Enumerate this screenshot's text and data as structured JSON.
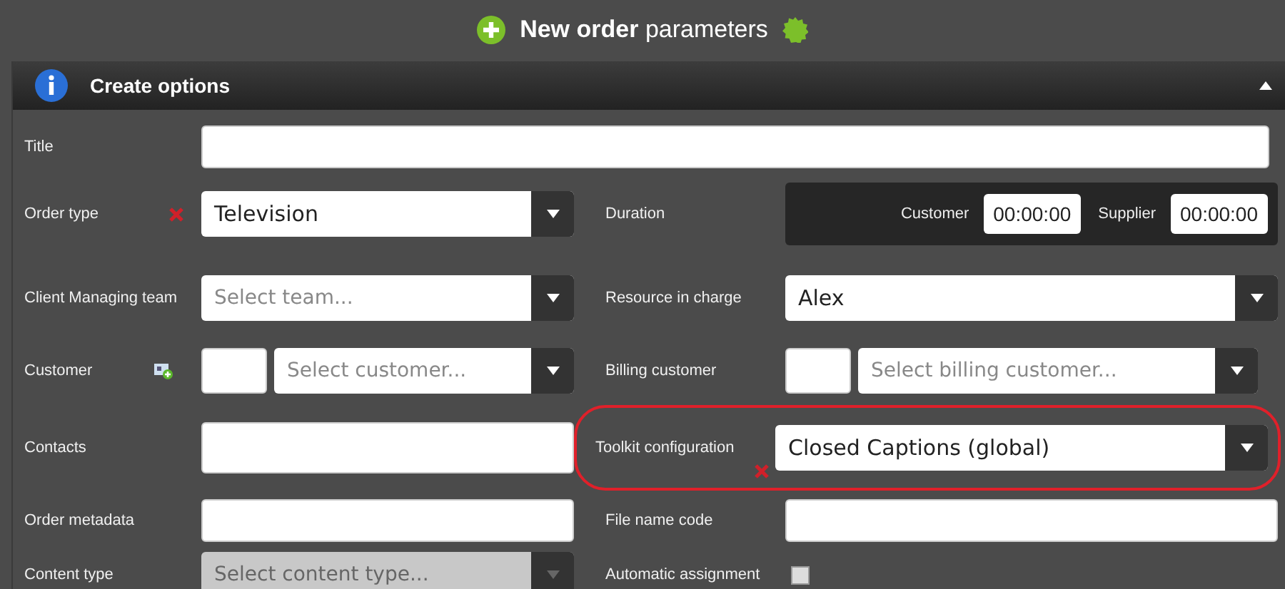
{
  "header": {
    "title": "**New order** parameters"
  },
  "section": {
    "title": "Create options",
    "expanded": true
  },
  "rows": [
    {
      "left": {
        "kind": "text",
        "label": "Title",
        "required": false,
        "highlighted": false
      }
    },
    {
      "left": {
        "kind": "select",
        "label": "Order type",
        "value": "Television",
        "required": true,
        "highlighted": false,
        "disabled": false
      },
      "right": {
        "kind": "duration",
        "label": "Duration",
        "required": false,
        "highlighted": false,
        "parts": [
          {
            "label": "Customer",
            "value": "00:00:00"
          },
          {
            "label": "Supplier",
            "value": "00:00:00"
          }
        ]
      }
    },
    {
      "left": {
        "kind": "select",
        "label": "Client Managing team",
        "placeholder": "Select team...",
        "required": false,
        "highlighted": false,
        "disabled": false
      },
      "right": {
        "kind": "select",
        "label": "Resource in charge",
        "value": "Alex",
        "required": false,
        "highlighted": false,
        "disabled": false
      }
    },
    {
      "left": {
        "kind": "code_select",
        "label": "Customer",
        "placeholder": "Select customer...",
        "required": false,
        "highlighted": false,
        "addable": true
      },
      "right": {
        "kind": "code_select",
        "label": "Billing customer",
        "placeholder": "Select billing customer...",
        "required": false,
        "highlighted": false,
        "addable": false
      }
    },
    {
      "left": {
        "kind": "text",
        "label": "Contacts",
        "required": false,
        "highlighted": false
      },
      "right": {
        "kind": "select",
        "label": "Toolkit configuration",
        "value": "Closed Captions (global)",
        "required": true,
        "highlighted": true,
        "disabled": false
      }
    },
    {
      "left": {
        "kind": "text",
        "label": "Order metadata",
        "required": false,
        "highlighted": false
      },
      "right": {
        "kind": "text",
        "label": "File name code",
        "required": false,
        "highlighted": false
      }
    },
    {
      "left": {
        "kind": "select",
        "label": "Content type",
        "placeholder": "Select content type...",
        "required": false,
        "highlighted": false,
        "disabled": true
      },
      "right": {
        "kind": "checkbox",
        "label": "Automatic assignment",
        "required": false,
        "highlighted": false,
        "checked": false
      }
    }
  ]
}
